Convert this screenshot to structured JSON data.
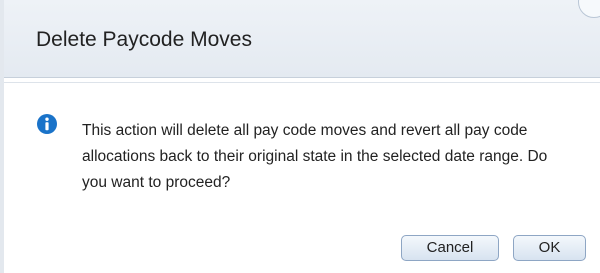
{
  "dialog": {
    "title": "Delete Paycode Moves",
    "message": "This action will delete all pay code moves and revert all pay code allocations back to their original state in the selected date range. Do you want to proceed?",
    "icon": "info-icon",
    "buttons": {
      "cancel_label": "Cancel",
      "ok_label": "OK"
    }
  },
  "colors": {
    "info_icon": "#1a73c9",
    "header_bg": "#e8edf3",
    "button_border": "#8ea6c4"
  }
}
